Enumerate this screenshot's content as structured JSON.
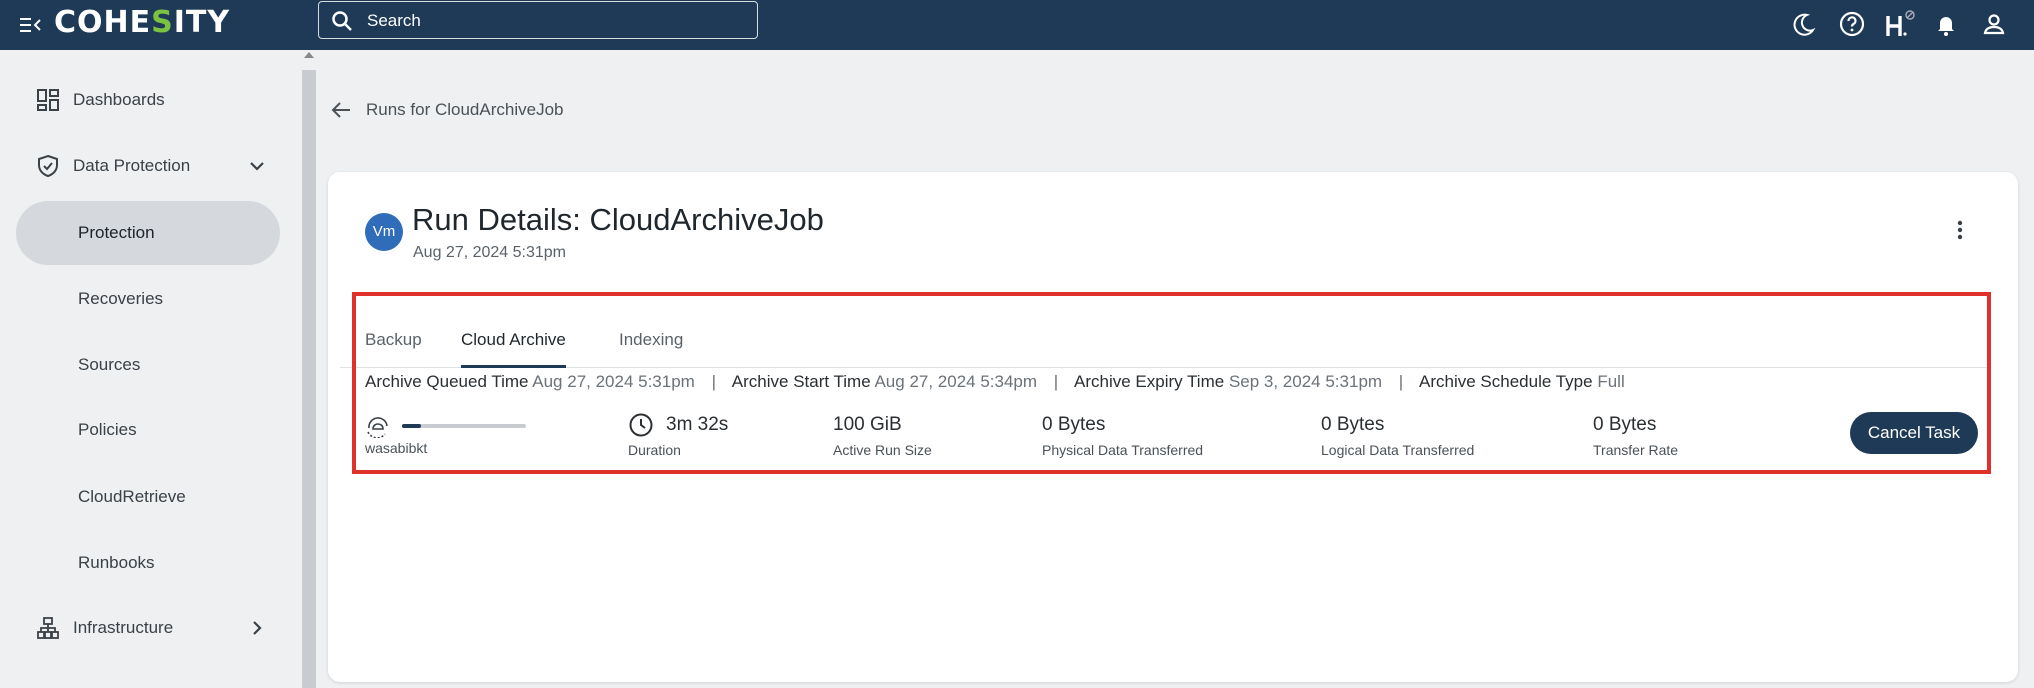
{
  "topbar": {
    "logo_text_a": "COHE",
    "logo_text_accent": "S",
    "logo_text_b": "ITY",
    "search_placeholder": "Search",
    "icons": [
      "menu-collapse-icon",
      "search-icon",
      "moon-icon",
      "help-icon",
      "helios-icon",
      "bell-icon",
      "user-icon"
    ]
  },
  "sidebar": {
    "items": [
      {
        "label": "Dashboards",
        "icon": "dashboard-icon"
      },
      {
        "label": "Data Protection",
        "icon": "shield-icon"
      },
      {
        "label": "Protection"
      },
      {
        "label": "Recoveries"
      },
      {
        "label": "Sources"
      },
      {
        "label": "Policies"
      },
      {
        "label": "CloudRetrieve"
      },
      {
        "label": "Runbooks"
      },
      {
        "label": "Infrastructure",
        "icon": "infrastructure-icon"
      }
    ]
  },
  "main": {
    "back_label": "Runs for CloudArchiveJob",
    "avatar_text": "Vm",
    "title": "Run Details: CloudArchiveJob",
    "subtitle": "Aug 27, 2024 5:31pm",
    "tabs": [
      {
        "label": "Backup"
      },
      {
        "label": "Cloud Archive"
      },
      {
        "label": "Indexing"
      }
    ],
    "meta": {
      "queued_key": "Archive Queued Time",
      "queued_val": "Aug 27, 2024 5:31pm",
      "start_key": "Archive Start Time",
      "start_val": "Aug 27, 2024 5:34pm",
      "expiry_key": "Archive Expiry Time",
      "expiry_val": "Sep 3, 2024 5:31pm",
      "schedule_key": "Archive Schedule Type",
      "schedule_val": "Full",
      "separator": "|"
    },
    "target": {
      "name": "wasabibkt",
      "progress_fraction": 0.15
    },
    "stats": [
      {
        "value": "3m 32s",
        "caption": "Duration"
      },
      {
        "value": "100 GiB",
        "caption": "Active Run Size"
      },
      {
        "value": "0 Bytes",
        "caption": "Physical Data Transferred"
      },
      {
        "value": "0 Bytes",
        "caption": "Logical Data Transferred"
      },
      {
        "value": "0 Bytes",
        "caption": "Transfer Rate"
      }
    ],
    "cancel_label": "Cancel Task"
  },
  "colors": {
    "topbar": "#1e3a56",
    "accent_green": "#7cc242",
    "highlight_red": "#e0302a",
    "avatar_blue": "#2f6cba"
  }
}
